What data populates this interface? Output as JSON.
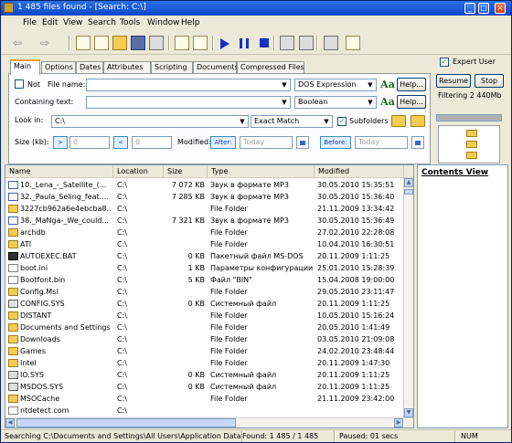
{
  "window": {
    "title": "1 485 files found - [Search: C:\\]"
  },
  "menu": [
    "File",
    "Edit",
    "View",
    "Search",
    "Tools",
    "Window",
    "Help"
  ],
  "tabs": [
    "Main",
    "Options",
    "Dates",
    "Attributes",
    "Scripting",
    "Documents",
    "Compressed Files"
  ],
  "search": {
    "not_label": "Not",
    "file_name_label": "File name:",
    "file_name_value": "",
    "file_name_mode": "DOS Expression",
    "containing_label": "Containing text:",
    "containing_value": "",
    "containing_mode": "Boolean",
    "help_label": "Help...",
    "look_in_label": "Look in:",
    "look_in_value": "C:\\",
    "match_mode": "Exact Match",
    "subfolders_label": "Subfolders",
    "size_label": "Size (kb):",
    "size_gt": ">",
    "size_lt": "<",
    "size_min": "0",
    "size_max": "0",
    "modified_label": "Modified:",
    "after_label": "After:",
    "after_value": "Today",
    "before_label": "Before:",
    "before_value": "Today"
  },
  "side": {
    "expert_label": "Expert User",
    "resume_label": "Resume",
    "stop_label": "Stop",
    "filtering_text": "Filtering 2 440Mb"
  },
  "columns": [
    "Name",
    "Location",
    "Size",
    "Type",
    "Modified"
  ],
  "rows": [
    {
      "icon": "mp3",
      "name": "10._Lena_-_Satellite_(...",
      "location": "C:\\",
      "size": "7 072 KB",
      "type": "Звук в формате MP3",
      "modified": "30.05.2010 15:35:51"
    },
    {
      "icon": "mp3",
      "name": "32._Paula_Seling_feat....",
      "location": "C:\\",
      "size": "7 285 KB",
      "type": "Звук в формате MP3",
      "modified": "30.05.2010 15:36:40"
    },
    {
      "icon": "folder",
      "name": "3227cb962a6e4ebcba8...",
      "location": "C:\\",
      "size": "",
      "type": "File Folder",
      "modified": "21.11.2009 13:34:42"
    },
    {
      "icon": "mp3",
      "name": "38._MaNga-_We_could...",
      "location": "C:\\",
      "size": "7 321 KB",
      "type": "Звук в формате MP3",
      "modified": "30.05.2010 15:36:49"
    },
    {
      "icon": "folder",
      "name": "archdb",
      "location": "C:\\",
      "size": "",
      "type": "File Folder",
      "modified": "27.02.2010 22:28:08"
    },
    {
      "icon": "folder",
      "name": "ATI",
      "location": "C:\\",
      "size": "",
      "type": "File Folder",
      "modified": "10.04.2010 16:30:51"
    },
    {
      "icon": "exe",
      "name": "AUTOEXEC.BAT",
      "location": "C:\\",
      "size": "0 KB",
      "type": "Пакетный файл MS-DOS",
      "modified": "20.11.2009 1:11:25"
    },
    {
      "icon": "file",
      "name": "boot.ini",
      "location": "C:\\",
      "size": "1 KB",
      "type": "Параметры конфигурации",
      "modified": "25.01.2010 15:28:39"
    },
    {
      "icon": "file",
      "name": "Bootfont.bin",
      "location": "C:\\",
      "size": "5 KB",
      "type": "Файл \"BIN\"",
      "modified": "15.04.2008 19:00:00"
    },
    {
      "icon": "folder",
      "name": "Config.Msi",
      "location": "C:\\",
      "size": "",
      "type": "File Folder",
      "modified": "29.05.2010 23:11:47"
    },
    {
      "icon": "sys",
      "name": "CONFIG.SYS",
      "location": "C:\\",
      "size": "0 KB",
      "type": "Системный файл",
      "modified": "20.11.2009 1:11:25"
    },
    {
      "icon": "folder",
      "name": "DISTANT",
      "location": "C:\\",
      "size": "",
      "type": "File Folder",
      "modified": "10.05.2010 15:16:24"
    },
    {
      "icon": "folder",
      "name": "Documents and Settings",
      "location": "C:\\",
      "size": "",
      "type": "File Folder",
      "modified": "20.05.2010 1:41:49"
    },
    {
      "icon": "folder",
      "name": "Downloads",
      "location": "C:\\",
      "size": "",
      "type": "File Folder",
      "modified": "03.05.2010 21:09:08"
    },
    {
      "icon": "folder",
      "name": "Games",
      "location": "C:\\",
      "size": "",
      "type": "File Folder",
      "modified": "24.02.2010 23:48:44"
    },
    {
      "icon": "folder",
      "name": "Intel",
      "location": "C:\\",
      "size": "",
      "type": "File Folder",
      "modified": "20.11.2009 1:47:30"
    },
    {
      "icon": "sys",
      "name": "IO.SYS",
      "location": "C:\\",
      "size": "0 KB",
      "type": "Системный файл",
      "modified": "20.11.2009 1:11:25"
    },
    {
      "icon": "sys",
      "name": "MSDOS.SYS",
      "location": "C:\\",
      "size": "0 KB",
      "type": "Системный файл",
      "modified": "20.11.2009 1:11:25"
    },
    {
      "icon": "folder",
      "name": "MSOCache",
      "location": "C:\\",
      "size": "",
      "type": "File Folder",
      "modified": "21.11.2009 23:42:00"
    },
    {
      "icon": "file",
      "name": "ntdetect.com",
      "location": "C:\\",
      "size": "",
      "type": "",
      "modified": ""
    }
  ],
  "contents_view_label": "Contents View",
  "status": {
    "searching": "Searching C:\\Documents and Settings\\All Users\\Application Data\\...",
    "found": "Found: 1 485 / 1 485",
    "paused": "Paused: 01 secs",
    "num": "NUM"
  }
}
